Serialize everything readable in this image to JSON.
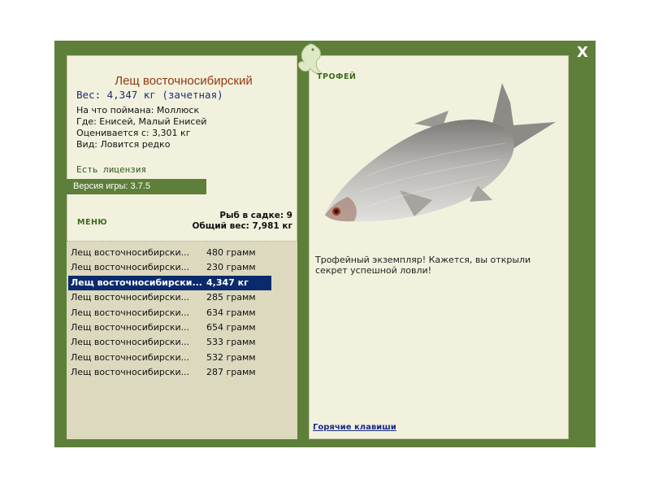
{
  "close_label": "X",
  "fish": {
    "title": "Лещ восточносибирский",
    "weight": "Вес: 4,347 кг (зачетная)",
    "caught_on": "На что поймана: Моллюск",
    "location": "Где: Енисей, Малый Енисей",
    "valued_from": "Оценивается с: 3,301 кг",
    "kind": "Вид: Ловится редко"
  },
  "license": "Есть лицензия",
  "version": "Версия игры: 3.7.5",
  "menu_label": "МЕНЮ",
  "keepnet": {
    "count": "Рыб в садке: 9",
    "total": "Общий вес: 7,981 кг"
  },
  "catch_list": [
    {
      "name": "Лещ восточносибирски...",
      "weight": "480 грамм"
    },
    {
      "name": "Лещ восточносибирски...",
      "weight": "230 грамм"
    },
    {
      "name": "Лещ восточносибирски...",
      "weight": "4,347 кг",
      "selected": true
    },
    {
      "name": "Лещ восточносибирски...",
      "weight": "285 грамм"
    },
    {
      "name": "Лещ восточносибирски...",
      "weight": "634 грамм"
    },
    {
      "name": "Лещ восточносибирски...",
      "weight": "654 грамм"
    },
    {
      "name": "Лещ восточносибирски...",
      "weight": "533 грамм"
    },
    {
      "name": "Лещ восточносибирски...",
      "weight": "532 грамм"
    },
    {
      "name": "Лещ восточносибирски...",
      "weight": "287 грамм"
    }
  ],
  "trophy_label": "ТРОФЕЙ",
  "trophy_text": "Трофейный экземпляр! Кажется, вы открыли секрет успешной ловли!",
  "hotkeys_label": "Горячие клавиши",
  "colors": {
    "frame": "#5e7f39",
    "panel": "#f2f1de",
    "selection": "#0a2a6e",
    "title": "#8f3a12"
  }
}
